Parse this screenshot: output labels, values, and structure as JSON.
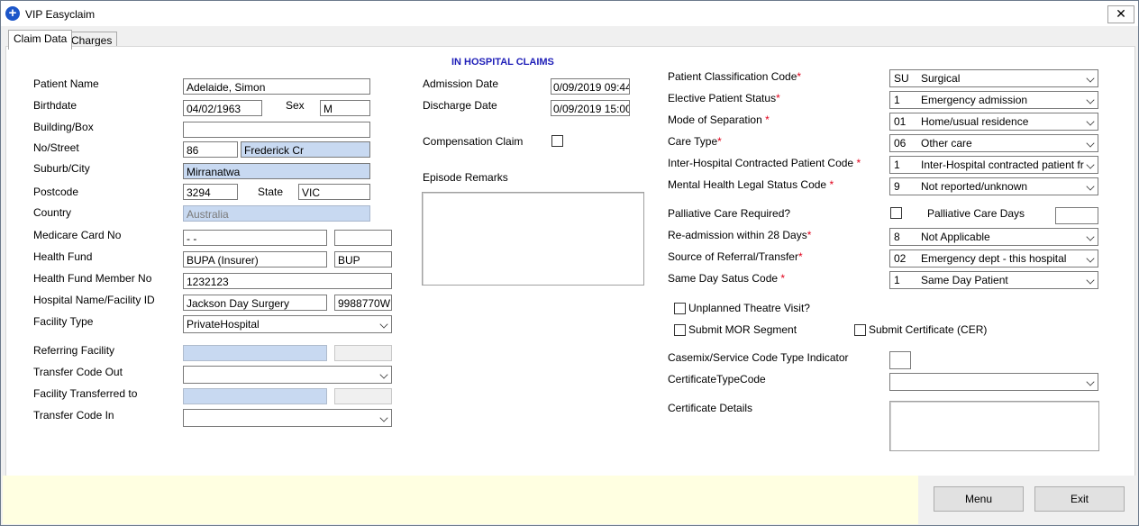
{
  "window": {
    "title": "VIP Easyclaim",
    "close_glyph": "✕",
    "app_icon_glyph": "+"
  },
  "tabs": [
    {
      "label": "Claim Data",
      "active": true
    },
    {
      "label": "Charges",
      "active": false
    }
  ],
  "heading": "IN HOSPITAL CLAIMS",
  "patient": {
    "name_label": "Patient Name",
    "name": "Adelaide, Simon",
    "birthdate_label": "Birthdate",
    "birthdate": "04/02/1963",
    "sex_label": "Sex",
    "sex": "M",
    "building_label": "Building/Box",
    "building": "",
    "street_label": "No/Street",
    "street_no": "86",
    "street_name": "Frederick Cr",
    "suburb_label": "Suburb/City",
    "suburb": "Mirranatwa",
    "postcode_label": "Postcode",
    "postcode": "3294",
    "state_label": "State",
    "state": "VIC",
    "country_label": "Country",
    "country": "Australia",
    "medicare_label": "Medicare Card No",
    "medicare": " -   -",
    "medicare_ref": "",
    "fund_label": "Health Fund",
    "fund": "BUPA (Insurer)",
    "fund_code": "BUP",
    "member_label": "Health Fund Member No",
    "member": "1232123",
    "hospital_label": "Hospital Name/Facility ID",
    "hospital": "Jackson Day Surgery",
    "facility_id": "9988770W",
    "facility_type_label": "Facility Type",
    "facility_type": "PrivateHospital",
    "referring_label": "Referring Facility",
    "transfer_out_label": "Transfer Code Out",
    "transferred_to_label": "Facility Transferred to",
    "transfer_in_label": "Transfer Code In"
  },
  "admission": {
    "admission_label": "Admission Date",
    "admission": "0/09/2019 09:44",
    "discharge_label": "Discharge Date",
    "discharge": "0/09/2019 15:00",
    "compensation_label": "Compensation Claim",
    "remarks_label": "Episode Remarks"
  },
  "classification": {
    "patient_class_label": "Patient Classification Code",
    "patient_class_code": "SU",
    "patient_class_desc": "Surgical",
    "elective_label": "Elective Patient Status",
    "elective_code": "1",
    "elective_desc": "Emergency admission",
    "separation_label": "Mode of Separation",
    "separation_code": "01",
    "separation_desc": "Home/usual residence",
    "care_type_label": "Care Type",
    "care_type_code": "06",
    "care_type_desc": "Other care",
    "inter_hospital_label": "Inter-Hospital Contracted Patient Code",
    "inter_hospital_code": "1",
    "inter_hospital_desc": "Inter-Hospital contracted patient fr",
    "mental_health_label": "Mental Health Legal Status Code",
    "mental_health_code": "9",
    "mental_health_desc": "Not reported/unknown",
    "palliative_label": "Palliative Care Required?",
    "palliative_days_label": "Palliative Care Days",
    "readmission_label": "Re-admission within 28 Days",
    "readmission_code": "8",
    "readmission_desc": "Not Applicable",
    "referral_label": "Source of Referral/Transfer",
    "referral_code": "02",
    "referral_desc": "Emergency  dept - this hospital",
    "same_day_label": "Same Day Satus Code",
    "same_day_code": "1",
    "same_day_desc": "Same Day Patient",
    "unplanned_label": "Unplanned Theatre Visit?",
    "mor_label": "Submit MOR Segment",
    "cer_label": "Submit Certificate (CER)",
    "casemix_label": "Casemix/Service Code Type Indicator",
    "cert_type_label": "CertificateTypeCode",
    "cert_details_label": "Certificate Details",
    "required_mark": "*"
  },
  "buttons": {
    "menu": "Menu",
    "exit": "Exit"
  },
  "colors": {
    "heading": "#1f1fb8",
    "required": "#e0001a",
    "highlight_field": "#c8d9f1",
    "footer": "#ffffe1"
  }
}
